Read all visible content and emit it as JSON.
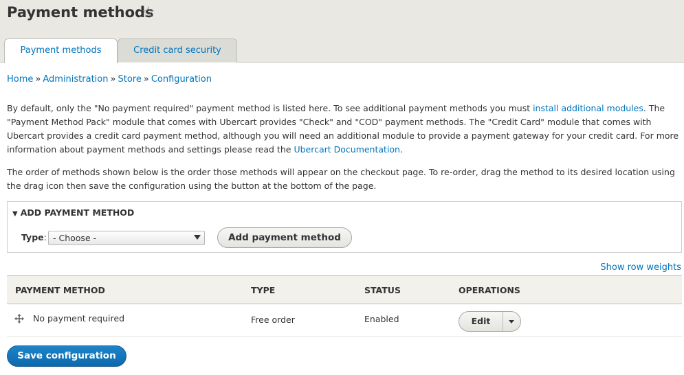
{
  "page": {
    "title": "Payment methods"
  },
  "tabs": [
    {
      "label": "Payment methods",
      "active": true
    },
    {
      "label": "Credit card security",
      "active": false
    }
  ],
  "breadcrumb": [
    "Home",
    "Administration",
    "Store",
    "Configuration"
  ],
  "breadcrumb_separator": "»",
  "description": {
    "p1_a": "By default, only the \"No payment required\" payment method is listed here. To see additional payment methods you must ",
    "p1_link1": "install additional modules",
    "p1_b": ". The \"Payment Method Pack\" module that comes with Ubercart provides \"Check\" and \"COD\" payment methods. The \"Credit Card\" module that comes with Ubercart provides a credit card payment method, although you will need an additional module to provide a payment gateway for your credit card. For more information about payment methods and settings please read the ",
    "p1_link2": "Ubercart Documentation",
    "p1_c": ".",
    "p2": "The order of methods shown below is the order those methods will appear on the checkout page. To re-order, drag the method to its desired location using the drag icon then save the configuration using the button at the bottom of the page."
  },
  "add_method": {
    "legend": "ADD PAYMENT METHOD",
    "type_label": "Type",
    "type_colon": ":",
    "select_value": "- Choose -",
    "button": "Add payment method"
  },
  "show_row_weights": "Show row weights",
  "table": {
    "headers": [
      "PAYMENT METHOD",
      "TYPE",
      "STATUS",
      "OPERATIONS"
    ],
    "rows": [
      {
        "method": "No payment required",
        "type": "Free order",
        "status": "Enabled",
        "operation": "Edit"
      }
    ]
  },
  "save_button": "Save configuration",
  "colors": {
    "link": "#0074bd",
    "primary_button": "#0c69ad",
    "header_bg": "#e9e8e3"
  },
  "icons": {
    "favorite": "star-outline-icon",
    "drag": "move-arrows-icon",
    "dropdown": "triangle-down-icon",
    "legend_toggle": "triangle-down-icon"
  }
}
